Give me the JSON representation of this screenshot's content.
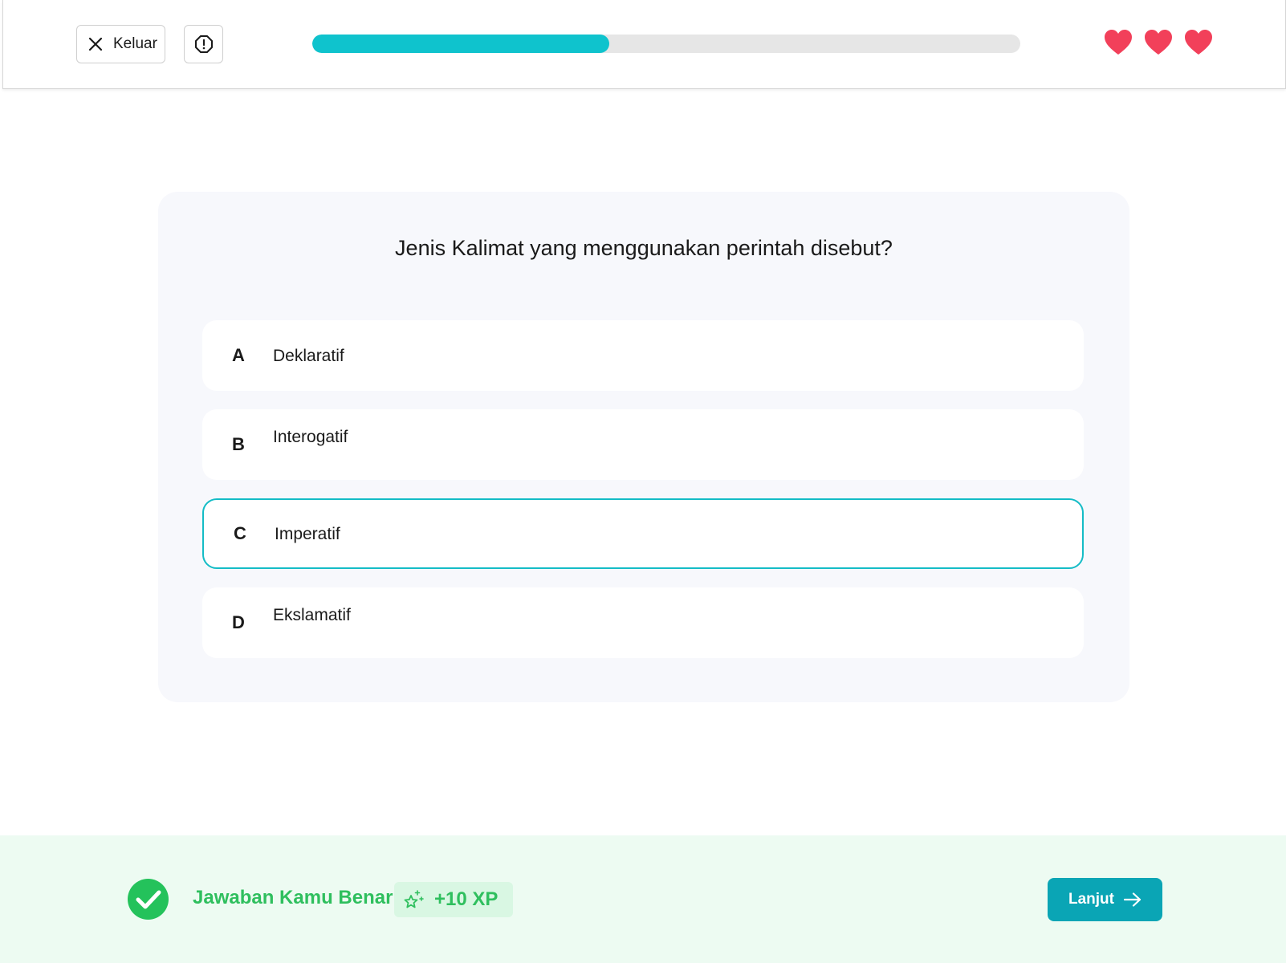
{
  "header": {
    "exit_label": "Keluar",
    "progress_fraction": 0.42,
    "lives": 3,
    "heart_color": "#f2405a",
    "accent": "#0fc3cd"
  },
  "quiz": {
    "question": "Jenis Kalimat yang menggunakan perintah disebut?",
    "options": [
      {
        "letter": "A",
        "text": "Deklaratif"
      },
      {
        "letter": "B",
        "text": "Interogatif"
      },
      {
        "letter": "C",
        "text": "Imperatif"
      },
      {
        "letter": "D",
        "text": "Ekslamatif"
      }
    ],
    "selected": "C"
  },
  "feedback": {
    "message": "Jawaban Kamu Benar",
    "xp": "+10 XP",
    "next_label": "Lanjut",
    "success_color": "#2fbf5e"
  }
}
